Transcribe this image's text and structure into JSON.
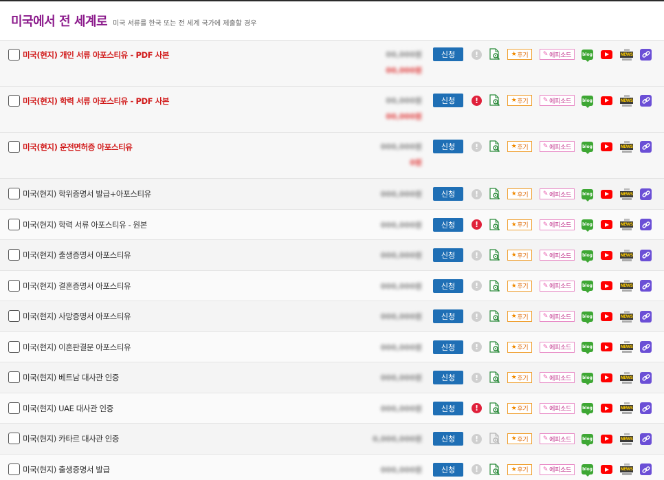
{
  "header": {
    "title": "미국에서 전 세계로",
    "subtitle": "미국 서류를 한국 또는 전 세계 국가에 제출할 경우"
  },
  "labels": {
    "apply": "신청",
    "alert": "!",
    "review": "후기",
    "review_star": "★",
    "episode": "에피소드",
    "blog": "blog",
    "news": "NEWS"
  },
  "colors": {
    "title": "#8b1a8b",
    "highlight_name": "#d11a1a",
    "apply_button": "#1f6fb5",
    "alert_active": "#e0203a",
    "alert_inactive": "#cfcfcf",
    "link_icon": "#6b4fd6"
  },
  "rows": [
    {
      "name": "미국(현지) 개인 서류 아포스티유 - PDF 사본",
      "highlight": true,
      "price": "00,000원",
      "sale": "00,000원",
      "alert": false,
      "search_active": true
    },
    {
      "name": "미국(현지) 학력 서류 아포스티유 - PDF 사본",
      "highlight": true,
      "price": "00,000원",
      "sale": "00,000원",
      "alert": true,
      "search_active": true
    },
    {
      "name": "미국(현지) 운전면허증 아포스티유",
      "highlight": true,
      "price": "000,000원",
      "sale": "0원",
      "alert": false,
      "search_active": true
    },
    {
      "name": "미국(현지) 학위증명서 발급+아포스티유",
      "highlight": false,
      "price": "000,000원",
      "sale": "",
      "alert": false,
      "search_active": true
    },
    {
      "name": "미국(현지) 학력 서류 아포스티유 - 원본",
      "highlight": false,
      "price": "000,000원",
      "sale": "",
      "alert": true,
      "search_active": true
    },
    {
      "name": "미국(현지) 출생증명서 아포스티유",
      "highlight": false,
      "price": "000,000원",
      "sale": "",
      "alert": false,
      "search_active": true
    },
    {
      "name": "미국(현지) 결혼증명서 아포스티유",
      "highlight": false,
      "price": "000,000원",
      "sale": "",
      "alert": false,
      "search_active": true
    },
    {
      "name": "미국(현지) 사망증명서 아포스티유",
      "highlight": false,
      "price": "000,000원",
      "sale": "",
      "alert": false,
      "search_active": true
    },
    {
      "name": "미국(현지) 이혼판결문 아포스티유",
      "highlight": false,
      "price": "000,000원",
      "sale": "",
      "alert": false,
      "search_active": true
    },
    {
      "name": "미국(현지) 베트남 대사관 인증",
      "highlight": false,
      "price": "000,000원",
      "sale": "",
      "alert": false,
      "search_active": true
    },
    {
      "name": "미국(현지) UAE 대사관 인증",
      "highlight": false,
      "price": "000,000원",
      "sale": "",
      "alert": true,
      "search_active": true
    },
    {
      "name": "미국(현지) 카타르 대사관 인증",
      "highlight": false,
      "price": "0,000,000원",
      "sale": "",
      "alert": false,
      "search_active": false
    },
    {
      "name": "미국(현지) 출생증명서 발급",
      "highlight": false,
      "price": "000,000원",
      "sale": "",
      "alert": false,
      "search_active": true
    }
  ]
}
